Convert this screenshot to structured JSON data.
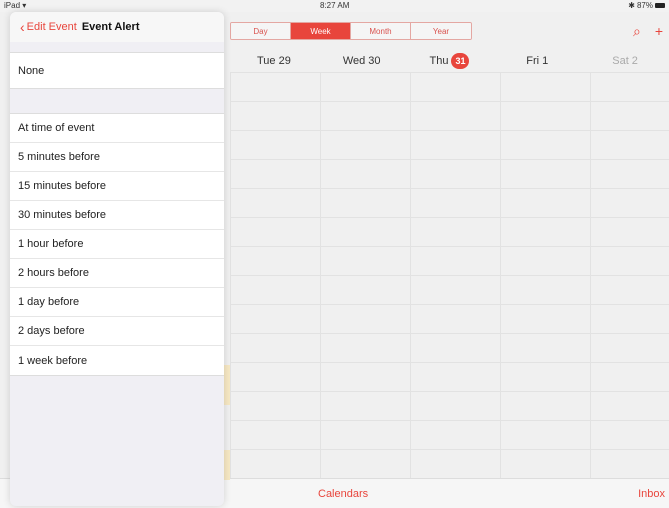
{
  "status_bar": {
    "device": "iPad",
    "time": "8:27 AM",
    "battery": "87%"
  },
  "calendar": {
    "views": [
      {
        "label": "Day",
        "active": false
      },
      {
        "label": "Week",
        "active": true
      },
      {
        "label": "Month",
        "active": false
      },
      {
        "label": "Year",
        "active": false
      }
    ],
    "days": [
      {
        "label": "Tue 29"
      },
      {
        "label": "Wed 30"
      },
      {
        "label": "Thu",
        "badge": "31"
      },
      {
        "label": "Fri 1"
      },
      {
        "label": "Sat 2"
      }
    ],
    "bottom_bar": {
      "calendars": "Calendars",
      "inbox": "Inbox"
    },
    "accent_color": "#e8453c"
  },
  "panel": {
    "back_label": "Edit Event",
    "title": "Event Alert",
    "none_option": "None",
    "options": [
      "At time of event",
      "5 minutes before",
      "15 minutes before",
      "30 minutes before",
      "1 hour before",
      "2 hours before",
      "1 day before",
      "2 days before",
      "1 week before"
    ]
  }
}
